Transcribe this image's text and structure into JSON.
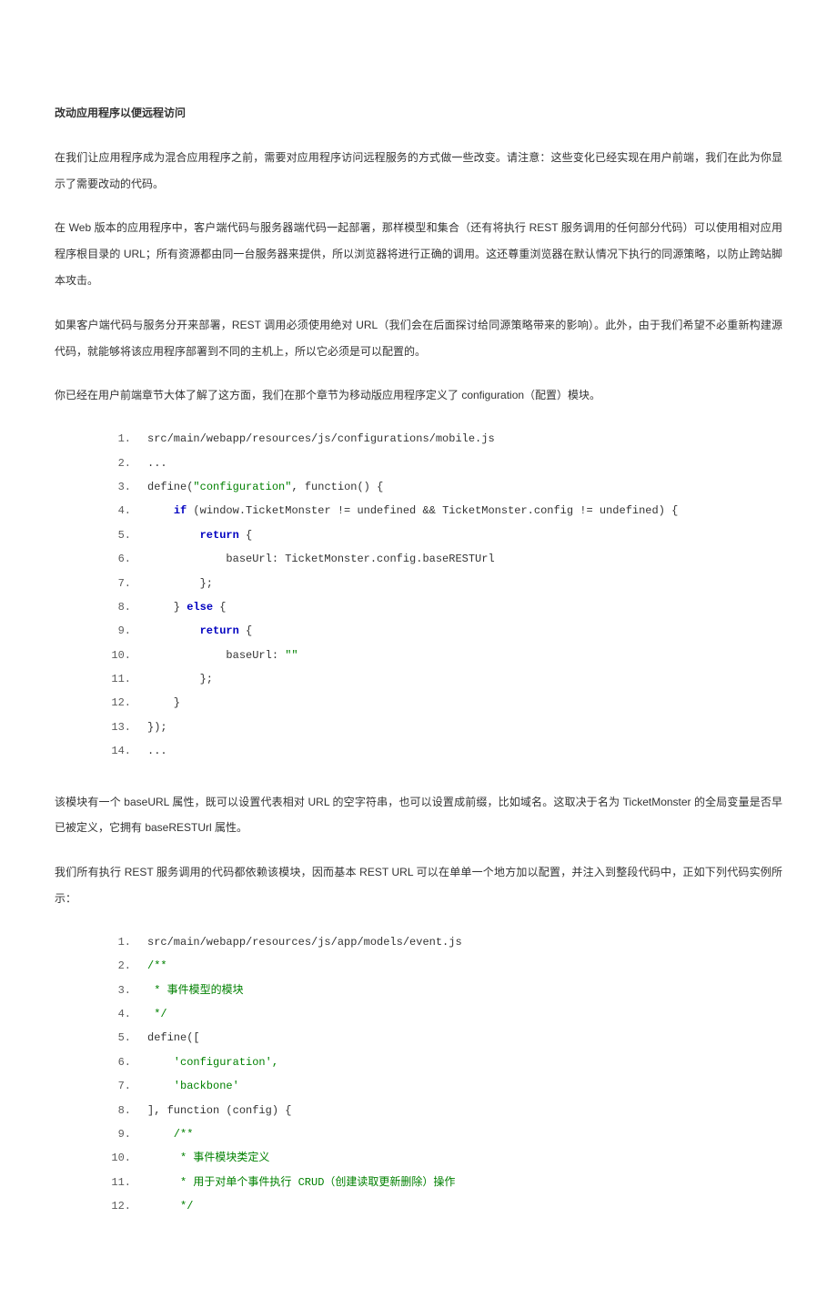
{
  "heading": "改动应用程序以便远程访问",
  "paras": {
    "p1": "在我们让应用程序成为混合应用程序之前，需要对应用程序访问远程服务的方式做一些改变。请注意：这些变化已经实现在用户前端，我们在此为你显示了需要改动的代码。",
    "p2": "在 Web 版本的应用程序中，客户端代码与服务器端代码一起部署，那样模型和集合（还有将执行 REST 服务调用的任何部分代码）可以使用相对应用程序根目录的 URL；所有资源都由同一台服务器来提供，所以浏览器将进行正确的调用。这还尊重浏览器在默认情况下执行的同源策略，以防止跨站脚本攻击。",
    "p3": "如果客户端代码与服务分开来部署，REST 调用必须使用绝对 URL（我们会在后面探讨给同源策略带来的影响）。此外，由于我们希望不必重新构建源代码，就能够将该应用程序部署到不同的主机上，所以它必须是可以配置的。",
    "p4": "你已经在用户前端章节大体了解了这方面，我们在那个章节为移动版应用程序定义了 configuration（配置）模块。",
    "p5": "该模块有一个 baseURL 属性，既可以设置代表相对 URL 的空字符串，也可以设置成前缀，比如域名。这取决于名为 TicketMonster 的全局变量是否早已被定义，它拥有 baseRESTUrl 属性。",
    "p6": "我们所有执行 REST 服务调用的代码都依赖该模块，因而基本 REST URL 可以在单单一个地方加以配置，并注入到整段代码中，正如下列代码实例所示："
  },
  "code1": {
    "l1": "src/main/webapp/resources/js/configurations/mobile.js",
    "l2": "...",
    "l3a": "define(",
    "l3b": "\"configuration\"",
    "l3c": ", function() {",
    "l4a": "    ",
    "l4b": "if",
    "l4c": " (window.TicketMonster != undefined && TicketMonster.config != undefined) {",
    "l5a": "        ",
    "l5b": "return",
    "l5c": " {",
    "l6": "            baseUrl: TicketMonster.config.baseRESTUrl",
    "l7": "        };",
    "l8a": "    } ",
    "l8b": "else",
    "l8c": " {",
    "l9a": "        ",
    "l9b": "return",
    "l9c": " {",
    "l10a": "            baseUrl: ",
    "l10b": "\"\"",
    "l11": "        };",
    "l12": "    }",
    "l13": "});",
    "l14": "..."
  },
  "code2": {
    "l1": "src/main/webapp/resources/js/app/models/event.js",
    "l2": "/**",
    "l3": " * 事件模型的模块",
    "l4": " */",
    "l5": "define([",
    "l6": "    'configuration',",
    "l7": "    'backbone'",
    "l8": "], function (config) {",
    "l9": "    /**",
    "l10a": "     * 事件模块类定义",
    "l11a": "     * 用于对单个事件执行 CRUD（创建读取更新删除）操作",
    "l12": "     */"
  }
}
